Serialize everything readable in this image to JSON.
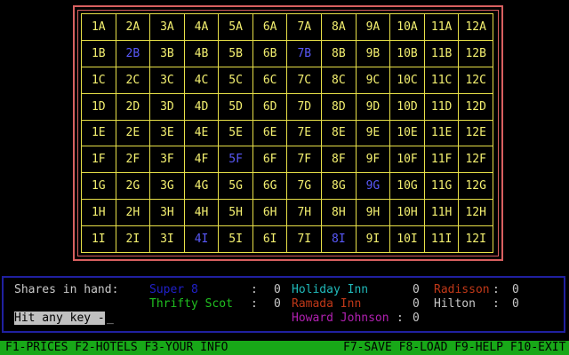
{
  "board": {
    "columns": [
      "1",
      "2",
      "3",
      "4",
      "5",
      "6",
      "7",
      "8",
      "9",
      "10",
      "11",
      "12"
    ],
    "rows": [
      "A",
      "B",
      "C",
      "D",
      "E",
      "F",
      "G",
      "H",
      "I"
    ],
    "placed": [
      "2B",
      "7B",
      "5F",
      "9G",
      "4I",
      "8I"
    ]
  },
  "info": {
    "shares_label": "Shares in hand:",
    "prompt": "Hit any key -",
    "cursor": "_",
    "hotels": [
      {
        "name": "Super 8",
        "value": "0",
        "color": "#2020c8"
      },
      {
        "name": "Holiday Inn",
        "value": "0",
        "color": "#20b8b8"
      },
      {
        "name": "Radisson",
        "value": "0",
        "color": "#c03818"
      },
      {
        "name": "Thrifty Scot",
        "value": "0",
        "color": "#20c020"
      },
      {
        "name": "Ramada Inn",
        "value": "0",
        "color": "#c03818"
      },
      {
        "name": "Hilton",
        "value": "0",
        "color": "#c8c8c8"
      },
      {
        "name": "Howard Johnson",
        "value": "0",
        "color": "#b020b0"
      }
    ]
  },
  "fkeys": {
    "left": "F1-PRICES F2-HOTELS F3-YOUR INFO",
    "right": "F7-SAVE F8-LOAD F9-HELP F10-EXIT"
  },
  "colors": {
    "grid": "#e8e048",
    "cell_text": "#f4f070",
    "placed_text": "#5858f8",
    "frame": "#d86060",
    "fkey_bar": "#18a818"
  }
}
